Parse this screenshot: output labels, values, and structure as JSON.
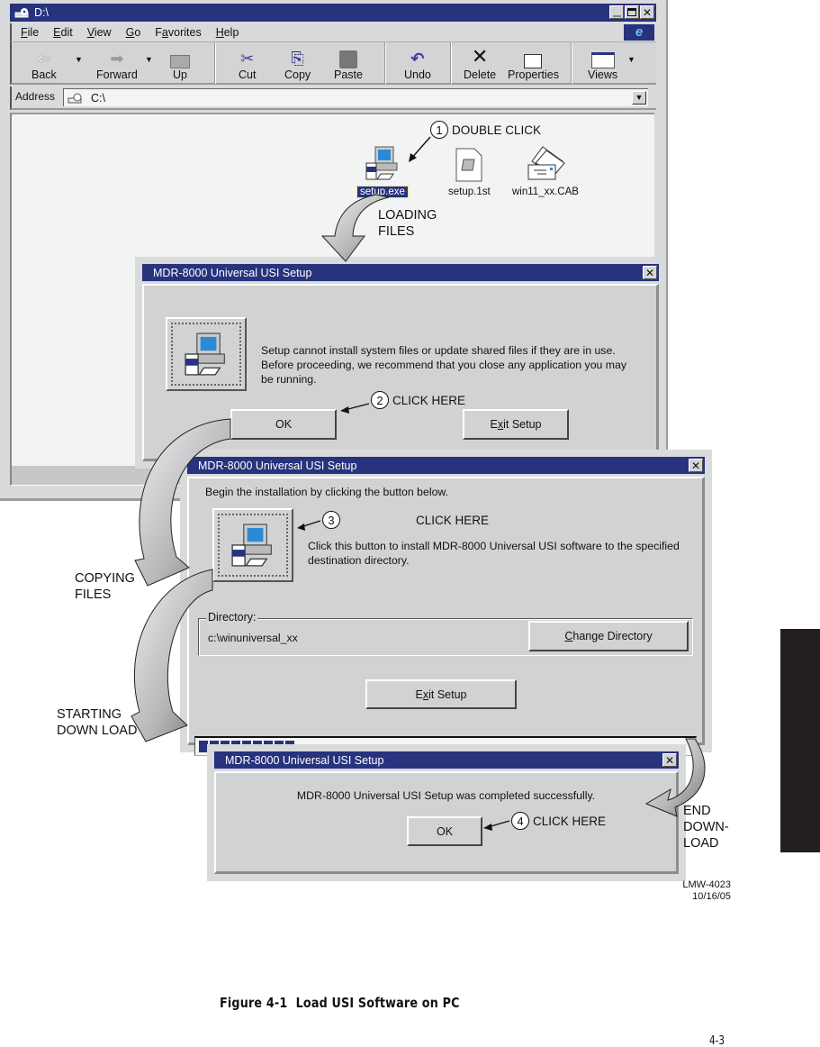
{
  "explorer": {
    "title": "D:\\",
    "window_buttons": [
      "minimize",
      "maximize",
      "close"
    ],
    "menu": [
      {
        "label": "File",
        "accel": "F"
      },
      {
        "label": "Edit",
        "accel": "E"
      },
      {
        "label": "View",
        "accel": "V"
      },
      {
        "label": "Go",
        "accel": "G"
      },
      {
        "label": "Favorites",
        "accel": "a"
      },
      {
        "label": "Help",
        "accel": "H"
      }
    ],
    "toolbar": {
      "back": "Back",
      "forward": "Forward",
      "up": "Up",
      "cut": "Cut",
      "copy": "Copy",
      "paste": "Paste",
      "undo": "Undo",
      "delete": "Delete",
      "properties": "Properties",
      "views": "Views"
    },
    "address": {
      "label": "Address",
      "value": "C:\\"
    },
    "files": [
      {
        "name": "setup.exe",
        "icon": "setup-installer-icon",
        "selected": true
      },
      {
        "name": "setup.1st",
        "icon": "document-icon",
        "selected": false
      },
      {
        "name": "win11_xx.CAB",
        "icon": "cabinet-archive-icon",
        "selected": false
      }
    ]
  },
  "callouts": {
    "step1": {
      "num": "1",
      "text": "DOUBLE CLICK"
    },
    "step2": {
      "num": "2",
      "text": "CLICK HERE"
    },
    "step3": {
      "num": "3",
      "text": "CLICK HERE"
    },
    "step4": {
      "num": "4",
      "text": "CLICK HERE"
    }
  },
  "flow_labels": {
    "loading": [
      "LOADING",
      "FILES"
    ],
    "copying": [
      "COPYING",
      "FILES"
    ],
    "starting": [
      "STARTING",
      "DOWN LOAD"
    ],
    "end": [
      "END",
      "DOWN-",
      "LOAD"
    ]
  },
  "dialog1": {
    "title": "MDR-8000 Universal USI Setup",
    "message": [
      "Setup cannot install system files or update shared files if they are in use.",
      "Before proceeding, we recommend that you close any application you may",
      "be running."
    ],
    "ok": "OK",
    "exit_pre": "E",
    "exit_accel": "x",
    "exit_post": "it Setup"
  },
  "dialog2": {
    "title": "MDR-8000 Universal USI Setup",
    "intro": "Begin the installation by clicking the button below.",
    "install_desc": [
      "Click this button to install MDR-8000 Universal USI software to the specified",
      "destination directory."
    ],
    "directory_label": "Directory:",
    "directory_value": "c:\\winuniversal_xx",
    "change_accel": "C",
    "change_post": "hange Directory",
    "exit_pre": "E",
    "exit_accel": "x",
    "exit_post": "it Setup",
    "progress_blocks_filled": 9
  },
  "dialog3": {
    "title": "MDR-8000 Universal USI Setup",
    "message": "MDR-8000 Universal USI Setup was completed successfully.",
    "ok": "OK"
  },
  "footer": {
    "drawing_id": "LMW-4023",
    "drawing_date": "10/16/05",
    "figure_caption": "Figure 4-1  Load USI Software on PC",
    "page_number": "4-3"
  },
  "colors": {
    "titlebar": "#27337d",
    "window_face": "#d1d2d4",
    "side_tab": "#231f20"
  }
}
